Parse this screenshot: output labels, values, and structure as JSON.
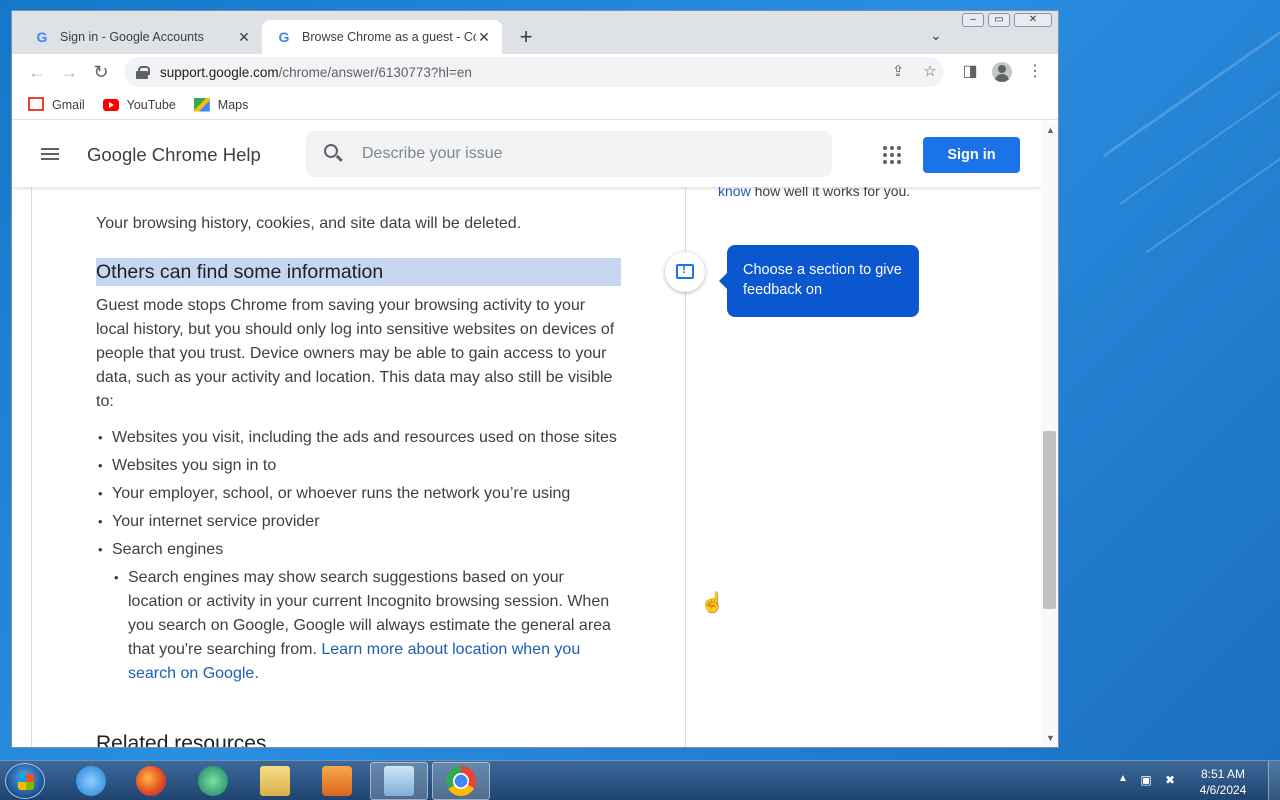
{
  "browser": {
    "tabs": [
      {
        "title": "Sign in - Google Accounts",
        "active": false
      },
      {
        "title": "Browse Chrome as a guest - Com",
        "active": true
      }
    ],
    "url_host": "support.google.com",
    "url_path": "/chrome/answer/6130773?hl=en",
    "bookmarks": [
      {
        "label": "Gmail",
        "icon": "gmail-icon"
      },
      {
        "label": "YouTube",
        "icon": "youtube-icon"
      },
      {
        "label": "Maps",
        "icon": "maps-icon"
      }
    ]
  },
  "help": {
    "title": "Google Chrome Help",
    "search_placeholder": "Describe your issue",
    "signin_label": "Sign in"
  },
  "article": {
    "intro": "Your browsing history, cookies, and site data will be deleted.",
    "heading": "Others can find some information",
    "body": "Guest mode stops Chrome from saving your browsing activity to your local history, but you should only log into sensitive websites on devices of people that you trust. Device owners may be able to gain access to your data, such as your activity and location. This data may also still be visible to:",
    "bullets": [
      "Websites you visit, including the ads and resources used on those sites",
      "Websites you sign in to",
      "Your employer, school, or whoever runs the network you’re using",
      "Your internet service provider",
      "Search engines"
    ],
    "sub_bullet_text": "Search engines may show search suggestions based on your location or activity in your current Incognito browsing session. When you search on Google, Google will always estimate the general area that you're searching from. ",
    "sub_bullet_link": "Learn more about location when you search on Google",
    "sub_bullet_end": ".",
    "related_heading": "Related resources"
  },
  "sidepanel": {
    "fragment_link": "know",
    "fragment_text": " how well it works for you.",
    "tooltip": "Choose a section to give feedback on"
  },
  "taskbar": {
    "time": "8:51 AM",
    "date": "4/6/2024"
  },
  "colors": {
    "accent": "#1a73e8",
    "heading_highlight": "#c7d7f2",
    "link": "#1a5fb4",
    "tooltip_bg": "#0b57d0"
  }
}
